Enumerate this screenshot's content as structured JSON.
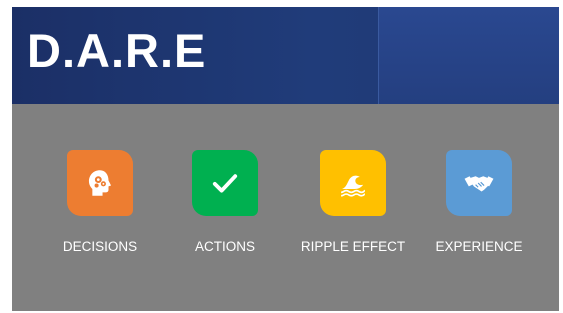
{
  "header": {
    "title": "D.A.R.E"
  },
  "colors": {
    "banner": "#1f3a7a",
    "background": "#808080"
  },
  "items": [
    {
      "label": "DECISIONS",
      "icon": "head-gears-icon",
      "color": "#ed7d31"
    },
    {
      "label": "ACTIONS",
      "icon": "checkmark-icon",
      "color": "#00b050"
    },
    {
      "label": "RIPPLE EFFECT",
      "icon": "wave-icon",
      "color": "#ffc000"
    },
    {
      "label": "EXPERIENCE",
      "icon": "handshake-icon",
      "color": "#5b9bd5"
    }
  ]
}
